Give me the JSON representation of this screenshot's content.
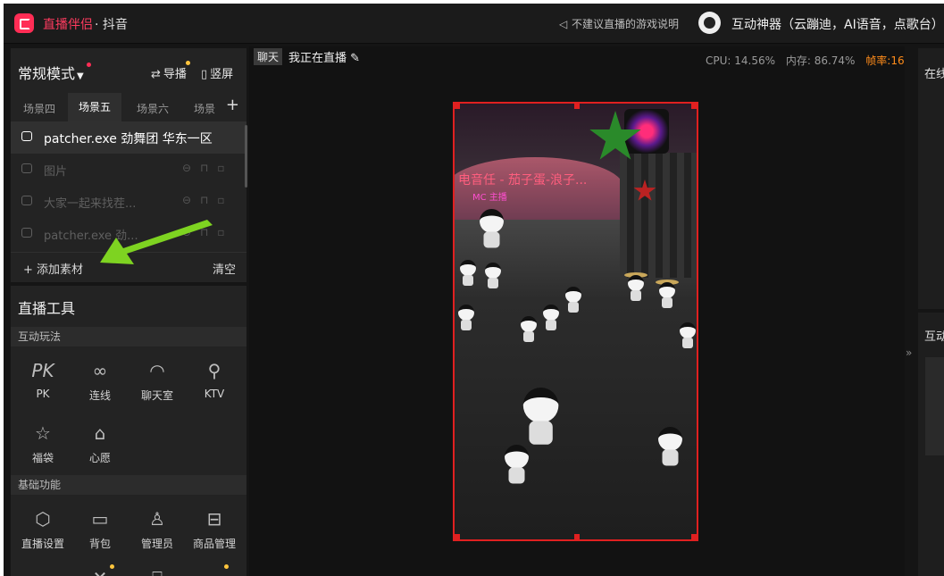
{
  "app": {
    "name": "直播伴侣",
    "separator_platform": "· 抖音"
  },
  "header": {
    "notice": "不建议直播的游戏说明",
    "tool_name": "互动神器（云蹦迪，AI语音，点歌台）"
  },
  "left": {
    "mode_label": "常规模式",
    "guide_label": "导播",
    "portrait_label": "竖屏",
    "scene_tabs": [
      "场景四",
      "场景五",
      "场景六",
      "场景"
    ],
    "sources": [
      {
        "label": "patcher.exe 劲舞团 华东一区"
      },
      {
        "label": "图片"
      },
      {
        "label": "大家一起来找茬..."
      },
      {
        "label": "patcher.exe 劲..."
      }
    ],
    "add_source": "添加素材",
    "clear": "清空",
    "tools_title": "直播工具",
    "section_interactive": "互动玩法",
    "interactive_tools": [
      {
        "label": "PK",
        "icon": "pk-icon"
      },
      {
        "label": "连线",
        "icon": "link-icon"
      },
      {
        "label": "聊天室",
        "icon": "chatroom-icon"
      },
      {
        "label": "KTV",
        "icon": "microphone-icon"
      },
      {
        "label": "福袋",
        "icon": "lucky-bag-icon"
      },
      {
        "label": "心愿",
        "icon": "wish-icon"
      }
    ],
    "section_basic": "基础功能",
    "basic_tools": [
      {
        "label": "直播设置",
        "icon": "settings-hex-icon"
      },
      {
        "label": "背包",
        "icon": "backpack-icon"
      },
      {
        "label": "管理员",
        "icon": "admin-icon"
      },
      {
        "label": "商品管理",
        "icon": "store-icon"
      }
    ]
  },
  "center": {
    "chat_tag": "聊天",
    "live_title": "我正在直播",
    "cpu": "CPU: 14.56%",
    "memory": "内存: 86.74%",
    "fps": "帧率:16",
    "overlay_text": "电音任 - 茄子蛋-浪子...",
    "mc_text": "MC 主播"
  },
  "right": {
    "online_label": "在线",
    "interactive_label": "互动"
  },
  "colors": {
    "accent": "#ff2d55",
    "preview_border": "#e02020",
    "fps": "#ff8c1a",
    "arrow": "#7ed321"
  }
}
